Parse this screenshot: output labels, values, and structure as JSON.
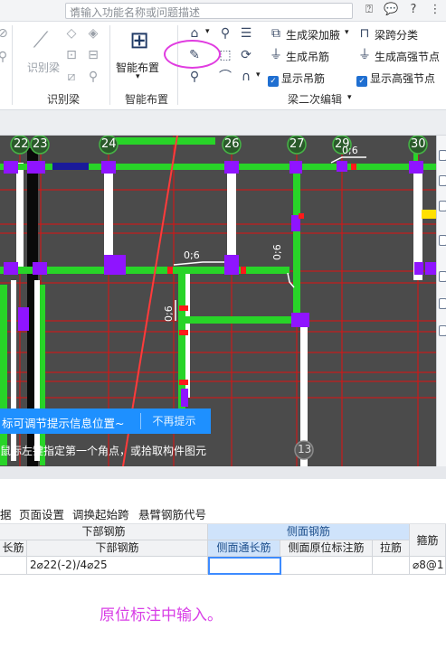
{
  "search": {
    "placeholder": "请输入功能名称或问题描述"
  },
  "topbar_icons": [
    "help-circle-icon",
    "chat-bubble-icon",
    "question-icon",
    "more-vertical-icon"
  ],
  "ribbon": {
    "group_identify": {
      "button_label": "识别梁",
      "group_label": "识别梁"
    },
    "group_smart": {
      "button_label": "智能布置",
      "group_label": "智能布置"
    },
    "group_edit": {
      "items": [
        {
          "label": "生成梁加腋",
          "has_dropdown": true
        },
        {
          "label": "梁跨分类"
        },
        {
          "label": "生成吊筋"
        },
        {
          "label": "生成高强节点"
        },
        {
          "label": "显示吊筋",
          "checked": true
        },
        {
          "label": "显示高强节点",
          "checked": true
        }
      ],
      "group_label": "梁二次编辑"
    }
  },
  "canvas": {
    "axis_labels": [
      "22",
      "23",
      "24",
      "26",
      "27",
      "29",
      "30"
    ],
    "dim_labels": [
      "0;6",
      "0;6",
      "0;6",
      "0;6"
    ],
    "bottom_axis_label": "13",
    "tip_message": "标可调节提示信息位置~",
    "tip_dismiss": "不再提示",
    "status_message": "鼠标左键指定第一个角点，或拾取构件图元"
  },
  "menubar": {
    "items": [
      "据",
      "页面设置",
      "调换起始跨",
      "悬臂钢筋代号"
    ]
  },
  "table": {
    "group_headers": {
      "bottom": "下部钢筋",
      "side": "侧面钢筋",
      "stirrup": "箍筋"
    },
    "columns": [
      "长筋",
      "下部钢筋",
      "侧面通长筋",
      "侧面原位标注筋",
      "拉筋",
      "箍筋"
    ],
    "row": {
      "bottom_rebar": "2⌀22(-2)/4⌀25",
      "side_through": "",
      "side_inplace": "",
      "tie": "",
      "stirrup": "⌀8@1"
    }
  },
  "annotation": "原位标注中输入。",
  "colors": {
    "annotation": "#d83ee6",
    "beam_green": "#28d428",
    "column_purple": "#8f14ff",
    "grid_red": "#e01010",
    "tip_blue": "#1e90ff"
  }
}
